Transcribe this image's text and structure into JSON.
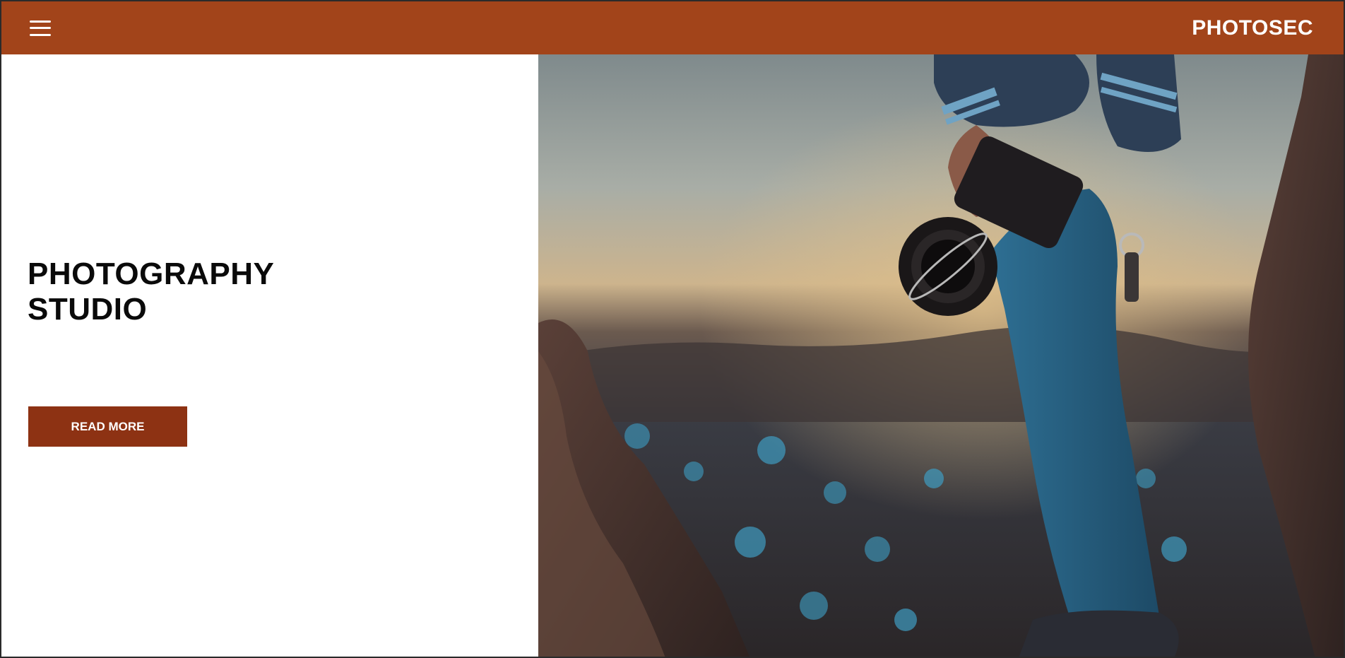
{
  "header": {
    "brand": "PHOTOSEC",
    "menu_icon": "hamburger-menu-icon",
    "background_color": "#a2441a"
  },
  "hero": {
    "title_line1": "PHOTOGRAPHY",
    "title_line2": "STUDIO",
    "button_label": "READ MORE",
    "button_color": "#8d3213"
  },
  "image": {
    "subject": "photographer-with-camera-on-rocks"
  }
}
